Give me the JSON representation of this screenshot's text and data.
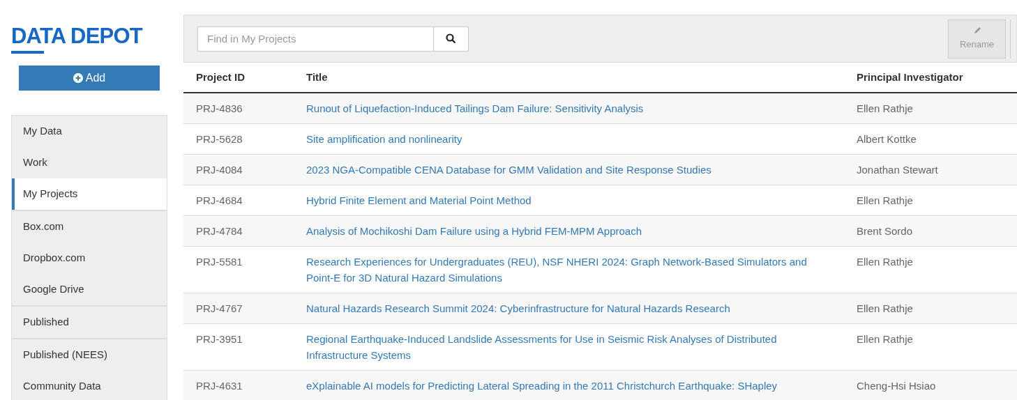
{
  "logo": "DATA DEPOT",
  "add_button": {
    "label": "Add"
  },
  "sidebar": {
    "groups": [
      {
        "items": [
          {
            "label": "My Data",
            "selected": false
          },
          {
            "label": "Work",
            "selected": false
          },
          {
            "label": "My Projects",
            "selected": true
          }
        ]
      },
      {
        "items": [
          {
            "label": "Box.com",
            "selected": false
          },
          {
            "label": "Dropbox.com",
            "selected": false
          },
          {
            "label": "Google Drive",
            "selected": false
          }
        ]
      },
      {
        "items": [
          {
            "label": "Published",
            "selected": false
          }
        ]
      },
      {
        "items": [
          {
            "label": "Published (NEES)",
            "selected": false
          },
          {
            "label": "Community Data",
            "selected": false
          }
        ]
      }
    ]
  },
  "toolbar": {
    "search": {
      "placeholder": "Find in My Projects"
    },
    "rename_button": {
      "label": "Rename",
      "disabled": true
    }
  },
  "table": {
    "columns": [
      "Project ID",
      "Title",
      "Principal Investigator"
    ],
    "rows": [
      [
        "PRJ-4836",
        "Runout of Liquefaction-Induced Tailings Dam Failure: Sensitivity Analysis",
        "Ellen Rathje"
      ],
      [
        "PRJ-5628",
        "Site amplification and nonlinearity",
        "Albert Kottke"
      ],
      [
        "PRJ-4084",
        "2023 NGA-Compatible CENA Database for GMM Validation and Site Response Studies",
        "Jonathan Stewart"
      ],
      [
        "PRJ-4684",
        "Hybrid Finite Element and Material Point Method",
        "Ellen Rathje"
      ],
      [
        "PRJ-4784",
        "Analysis of Mochikoshi Dam Failure using a Hybrid FEM-MPM Approach",
        "Brent Sordo"
      ],
      [
        "PRJ-5581",
        "Research Experiences for Undergraduates (REU), NSF NHERI 2024: Graph Network-Based Simulators and Point-E for 3D Natural Hazard Simulations",
        "Ellen Rathje"
      ],
      [
        "PRJ-4767",
        "Natural Hazards Research Summit 2024: Cyberinfrastructure for Natural Hazards Research",
        "Ellen Rathje"
      ],
      [
        "PRJ-3951",
        "Regional Earthquake-Induced Landslide Assessments for Use in Seismic Risk Analyses of Distributed Infrastructure Systems",
        "Ellen Rathje"
      ],
      [
        "PRJ-4631",
        "eXplainable AI models for Predicting Lateral Spreading in the 2011 Christchurch Earthquake: SHapley",
        "Cheng-Hsi Hsiao"
      ]
    ]
  }
}
